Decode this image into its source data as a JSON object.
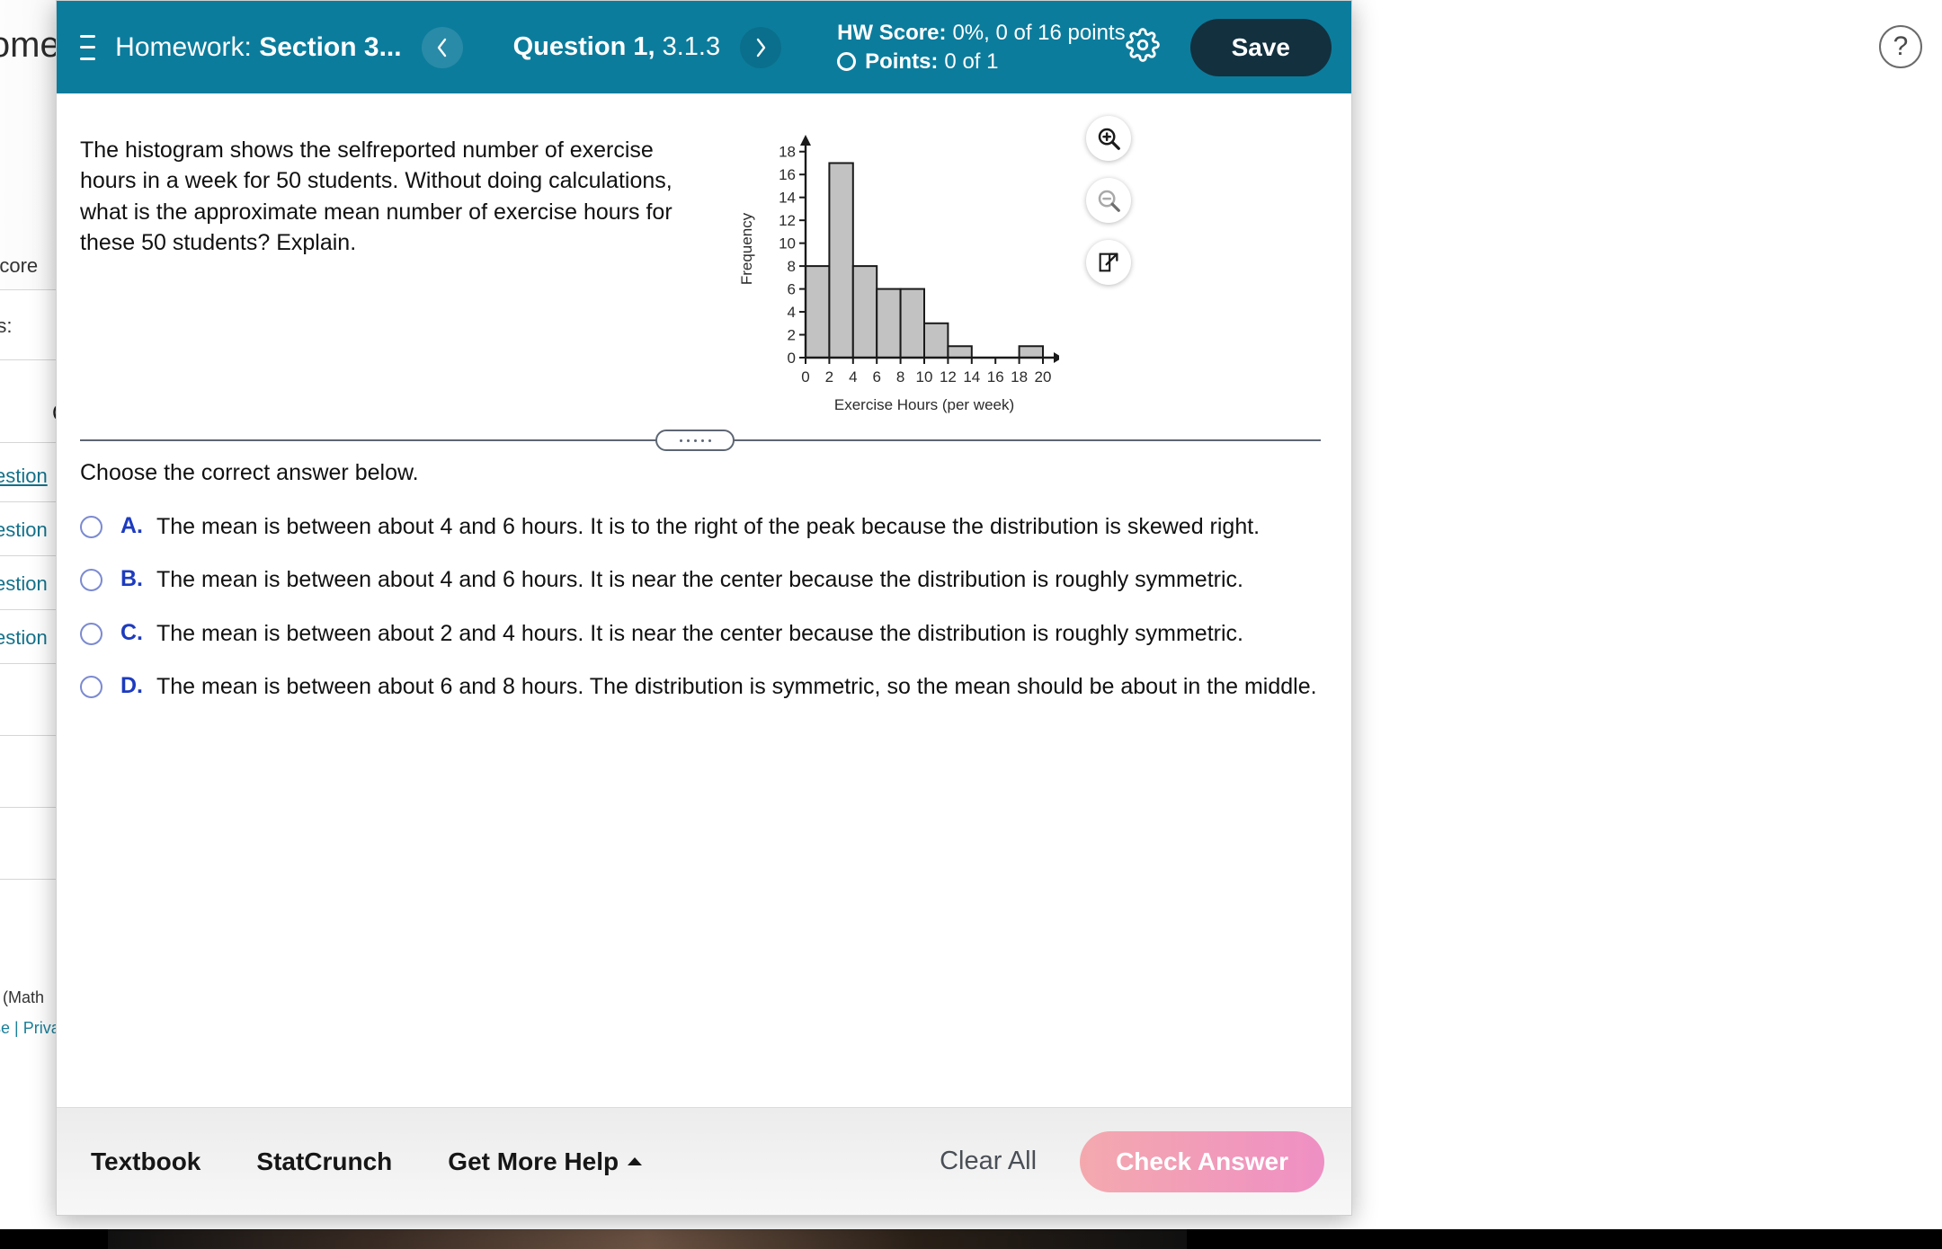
{
  "background": {
    "title": "Homework",
    "student_score_label": "ent Score",
    "points_label": "ots:",
    "question_col_header": "Q",
    "question_links": [
      "estion",
      "estion",
      "estion",
      "estion"
    ],
    "footer_text": "e (Math",
    "footer_links": "se | Priva"
  },
  "topbar": {
    "menu_icon": "hamburger-icon",
    "homework_prefix": "Homework:",
    "homework_name": "Section 3...",
    "prev_icon": "chevron-left-icon",
    "next_icon": "chevron-right-icon",
    "question_bold": "Question 1,",
    "question_id": "3.1.3",
    "hw_score_label": "HW Score:",
    "hw_score_value": "0%, 0 of 16 points",
    "points_label": "Points:",
    "points_value": "0 of 1",
    "settings_icon": "gear-icon",
    "save_label": "Save"
  },
  "help": {
    "icon": "question-mark-icon",
    "glyph": "?"
  },
  "question": {
    "text": "The histogram shows the selfreported number of exercise hours in a week for 50 students. Without doing calculations, what is the approximate mean number of exercise hours for these 50 students? Explain."
  },
  "chart_tools": [
    {
      "name": "zoom-in-icon",
      "enabled": true
    },
    {
      "name": "zoom-out-icon",
      "enabled": false
    },
    {
      "name": "popout-icon",
      "enabled": true
    }
  ],
  "chart_data": {
    "type": "bar",
    "title": "",
    "xlabel": "Exercise Hours (per week)",
    "ylabel": "Frequency",
    "categories": [
      "0-2",
      "2-4",
      "4-6",
      "6-8",
      "8-10",
      "10-12",
      "12-14",
      "14-16",
      "16-18",
      "18-20"
    ],
    "bin_starts": [
      0,
      2,
      4,
      6,
      8,
      10,
      12,
      14,
      16,
      18
    ],
    "values": [
      8,
      17,
      8,
      6,
      6,
      3,
      1,
      0,
      0,
      1
    ],
    "xticks": [
      "0",
      "2",
      "4",
      "6",
      "8",
      "10",
      "12",
      "14",
      "16",
      "18",
      "20"
    ],
    "yticks": [
      "0",
      "2",
      "4",
      "6",
      "8",
      "10",
      "12",
      "14",
      "16",
      "18"
    ],
    "xlim": [
      0,
      20
    ],
    "ylim": [
      0,
      19
    ],
    "grid": false,
    "legend": "none",
    "bar_fill": "#c2c2c2",
    "bar_stroke": "#1a1a1a"
  },
  "divider": {
    "handle_icon": "drag-handle-dots"
  },
  "answer_section": {
    "prompt": "Choose the correct answer below.",
    "options": [
      {
        "letter": "A.",
        "text": "The mean is between about 4 and 6 hours. It is to the right of the peak because the distribution is skewed right.",
        "selected": false
      },
      {
        "letter": "B.",
        "text": "The mean is between about 4 and 6 hours. It is near the center because the distribution is roughly symmetric.",
        "selected": false
      },
      {
        "letter": "C.",
        "text": "The mean is between about 2 and 4 hours. It is near the center because the distribution is roughly symmetric.",
        "selected": false
      },
      {
        "letter": "D.",
        "text": "The mean is between about 6 and 8 hours. The distribution is symmetric, so the mean should be about in the middle.",
        "selected": false
      }
    ]
  },
  "footer": {
    "textbook": "Textbook",
    "statcrunch": "StatCrunch",
    "get_more_help": "Get More Help",
    "clear_all": "Clear All",
    "check_answer": "Check Answer"
  },
  "colors": {
    "teal": "#0c7c9c",
    "save_dark": "#13303f",
    "link_blue": "#1d3bbf",
    "radio_blue": "#7b8ad1",
    "check_pink_start": "#f4a9ae",
    "check_pink_end": "#ef8fc4"
  }
}
